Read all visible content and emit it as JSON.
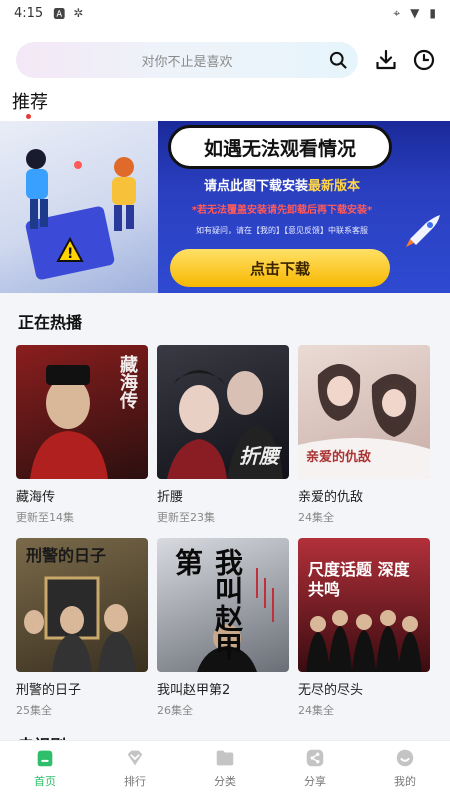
{
  "status_bar": {
    "time": "4:15",
    "left_icons": [
      "a-icon",
      "bug-icon"
    ],
    "right_icons": [
      "location-icon",
      "wifi-icon",
      "battery-icon"
    ]
  },
  "search": {
    "placeholder": "对你不止是喜欢"
  },
  "tabs": [
    {
      "label": "推荐",
      "active": true
    }
  ],
  "banner": {
    "title": "如遇无法观看情况",
    "line1_prefix": "请点此图下载安装",
    "line1_highlight": "最新版本",
    "line2": "*若无法覆盖安装请先卸载后再下载安装*",
    "line3": "如有疑问，请在【我的】【意见反馈】中联系客服",
    "button": "点击下载"
  },
  "now_playing": {
    "title": "正在热播",
    "items": [
      {
        "name": "藏海传",
        "status": "更新至14集",
        "poster_text": "藏海传",
        "color_a": "#8b1e1e",
        "color_b": "#2b0f0f"
      },
      {
        "name": "折腰",
        "status": "更新至23集",
        "poster_text": "折腰",
        "color_a": "#3a3a44",
        "color_b": "#101018"
      },
      {
        "name": "亲爱的仇敌",
        "status": "24集全",
        "poster_text": "亲爱的仇敌",
        "color_a": "#e8d6d0",
        "color_b": "#b89a96"
      },
      {
        "name": "刑警的日子",
        "status": "25集全",
        "poster_text": "刑警的日子",
        "color_a": "#7a6a4a",
        "color_b": "#3a3020"
      },
      {
        "name": "我叫赵甲第2",
        "status": "26集全",
        "poster_text": "我叫赵甲第",
        "color_a": "#c9ccd3",
        "color_b": "#5a5e66"
      },
      {
        "name": "无尽的尽头",
        "status": "24集全",
        "poster_text": "尺度话题 深度共鸣",
        "color_a": "#9a2a2a",
        "color_b": "#3a0c10"
      }
    ]
  },
  "next_section_title": "电视剧",
  "bottom_nav": [
    {
      "label": "首页",
      "icon": "home-icon",
      "active": true
    },
    {
      "label": "排行",
      "icon": "ranking-icon",
      "active": false
    },
    {
      "label": "分类",
      "icon": "category-icon",
      "active": false
    },
    {
      "label": "分享",
      "icon": "share-icon",
      "active": false
    },
    {
      "label": "我的",
      "icon": "profile-icon",
      "active": false
    }
  ],
  "colors": {
    "accent": "#2fbf6a",
    "banner_blue": "#2e4ad1",
    "banner_button": "#f7b800"
  }
}
